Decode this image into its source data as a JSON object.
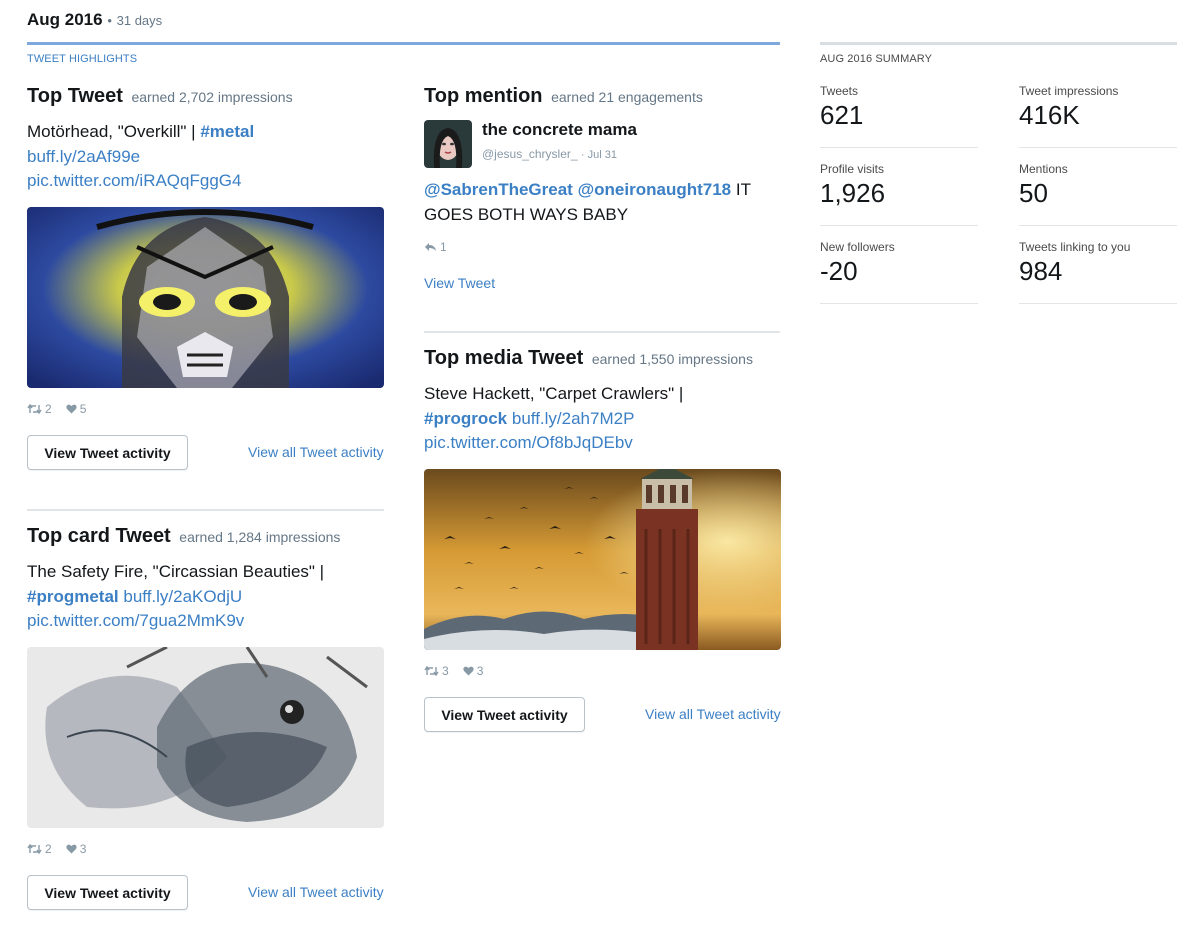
{
  "header": {
    "month": "Aug 2016",
    "sep": "•",
    "days": "31 days"
  },
  "highlights_label": "TWEET HIGHLIGHTS",
  "top_tweet": {
    "title": "Top Tweet",
    "earned": "earned 2,702 impressions",
    "text": "Motörhead, \"Overkill\" | ",
    "hashtag": "#metal",
    "link1": "buff.ly/2aAf99e",
    "link2": "pic.twitter.com/iRAQqFggG4",
    "retweets": "2",
    "likes": "5",
    "button": "View Tweet activity",
    "view_all": "View all Tweet activity"
  },
  "top_card": {
    "title": "Top card Tweet",
    "earned": "earned 1,284 impressions",
    "text": "The Safety Fire, \"Circassian Beauties\" |",
    "hashtag": "#progmetal",
    "link1": "buff.ly/2aKOdjU",
    "link2": "pic.twitter.com/7gua2MmK9v",
    "retweets": "2",
    "likes": "3",
    "button": "View Tweet activity",
    "view_all": "View all Tweet activity"
  },
  "top_mention": {
    "title": "Top mention",
    "earned": "earned 21 engagements",
    "user_name": "the concrete mama",
    "handle": "@jesus_chrysler_",
    "date": "· Jul 31",
    "mention1": "@SabrenTheGreat",
    "mention2": "@oneironaught718",
    "text_after": " IT GOES BOTH WAYS BABY",
    "replies": "1",
    "view_link": "View Tweet"
  },
  "top_media": {
    "title": "Top media Tweet",
    "earned": "earned 1,550 impressions",
    "text": "Steve Hackett, \"Carpet Crawlers\" |",
    "hashtag": "#progrock",
    "link1": "buff.ly/2ah7M2P",
    "link2": "pic.twitter.com/Of8bJqDEbv",
    "retweets": "3",
    "likes": "3",
    "button": "View Tweet activity",
    "view_all": "View all Tweet activity"
  },
  "summary": {
    "label": "AUG 2016 SUMMARY",
    "tweets_label": "Tweets",
    "tweets": "621",
    "impressions_label": "Tweet impressions",
    "impressions": "416K",
    "profile_label": "Profile visits",
    "profile": "1,926",
    "mentions_label": "Mentions",
    "mentions": "50",
    "followers_label": "New followers",
    "followers": "-20",
    "linking_label": "Tweets linking to you",
    "linking": "984"
  },
  "colors": {
    "link": "#3b7fc4",
    "highlight_rule": "#7fa9dc",
    "muted": "#657786"
  },
  "icons": {
    "retweet": "retweet-icon",
    "like": "heart-icon",
    "reply": "reply-icon"
  }
}
